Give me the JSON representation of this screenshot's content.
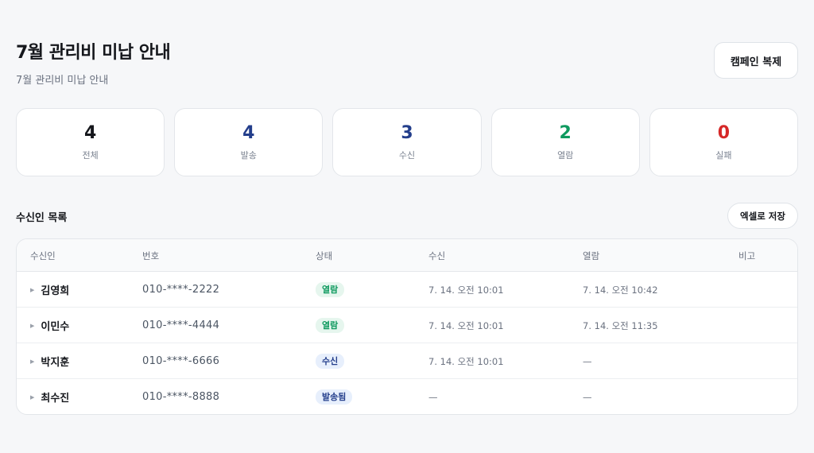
{
  "header": {
    "title": "7월 관리비 미납 안내",
    "subtitle": "7월 관리비 미납 안내",
    "clone_button": "캠페인 복제"
  },
  "stats": [
    {
      "value": "4",
      "label": "전체",
      "color": "#15171c"
    },
    {
      "value": "4",
      "label": "발송",
      "color": "#233e8b"
    },
    {
      "value": "3",
      "label": "수신",
      "color": "#233e8b"
    },
    {
      "value": "2",
      "label": "열람",
      "color": "#0f9a5f"
    },
    {
      "value": "0",
      "label": "실패",
      "color": "#d62828"
    }
  ],
  "recipients": {
    "title": "수신인 목록",
    "excel_button": "엑셀로 저장",
    "columns": [
      "수신인",
      "번호",
      "상태",
      "수신",
      "열람",
      "비고"
    ],
    "rows": [
      {
        "name": "김영희",
        "phone": "010-****-2222",
        "status": "열람",
        "status_type": "opened",
        "received": "7. 14. 오전 10:01",
        "opened": "7. 14. 오전 10:42",
        "note": ""
      },
      {
        "name": "이민수",
        "phone": "010-****-4444",
        "status": "열람",
        "status_type": "opened",
        "received": "7. 14. 오전 10:01",
        "opened": "7. 14. 오전 11:35",
        "note": ""
      },
      {
        "name": "박지훈",
        "phone": "010-****-6666",
        "status": "수신",
        "status_type": "received",
        "received": "7. 14. 오전 10:01",
        "opened": "—",
        "note": ""
      },
      {
        "name": "최수진",
        "phone": "010-****-8888",
        "status": "발송됨",
        "status_type": "sent",
        "received": "—",
        "opened": "—",
        "note": ""
      }
    ]
  },
  "icons": {
    "row_expand": "caret-right-icon"
  }
}
